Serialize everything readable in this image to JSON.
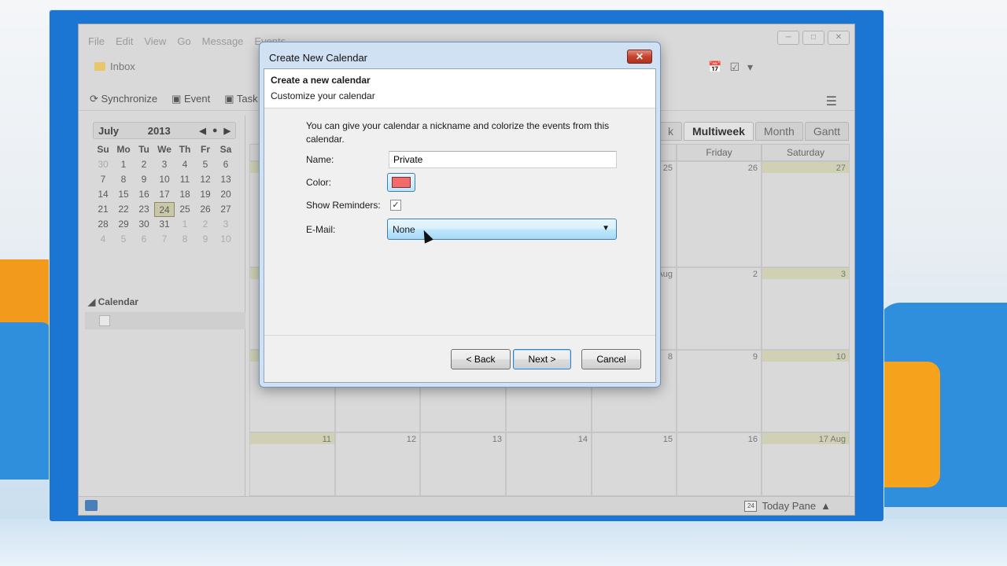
{
  "app": {
    "menu": [
      "File",
      "Edit",
      "View",
      "Go",
      "Message",
      "Events"
    ],
    "folder_tab": "Inbox",
    "toolbar": {
      "sync_label": "Synchronize",
      "event_label": "Event",
      "task_label": "Task"
    }
  },
  "mini_calendar": {
    "month": "July",
    "year": "2013",
    "weekdays": [
      "Su",
      "Mo",
      "Tu",
      "We",
      "Th",
      "Fr",
      "Sa"
    ],
    "days": [
      [
        "30",
        "1",
        "2",
        "3",
        "4",
        "5",
        "6"
      ],
      [
        "7",
        "8",
        "9",
        "10",
        "11",
        "12",
        "13"
      ],
      [
        "14",
        "15",
        "16",
        "17",
        "18",
        "19",
        "20"
      ],
      [
        "21",
        "22",
        "23",
        "24",
        "25",
        "26",
        "27"
      ],
      [
        "28",
        "29",
        "30",
        "31",
        "1",
        "2",
        "3"
      ],
      [
        "4",
        "5",
        "6",
        "7",
        "8",
        "9",
        "10"
      ]
    ],
    "today": "24"
  },
  "calendar_pane": {
    "header": "Calendar"
  },
  "views": {
    "partial": "k",
    "multiweek": "Multiweek",
    "month": "Month",
    "gantt": "Gantt"
  },
  "multiweek": {
    "day_headers": [
      "",
      "",
      "",
      "",
      "",
      "Friday",
      "Saturday"
    ],
    "rows": [
      [
        "",
        "",
        "",
        "",
        "25",
        "26",
        "27"
      ],
      [
        "",
        "",
        "",
        "",
        "Aug",
        "2",
        "3"
      ],
      [
        "",
        "",
        "",
        "",
        "8",
        "9",
        "10"
      ],
      [
        "11",
        "12",
        "13",
        "14",
        "15",
        "16",
        "17 Aug"
      ]
    ]
  },
  "status": {
    "today_pane": "Today Pane",
    "today_pane_date": "24"
  },
  "dialog": {
    "title": "Create New Calendar",
    "heading": "Create a new calendar",
    "subheading": "Customize your calendar",
    "description": "You can give your calendar a nickname and colorize the events from this calendar.",
    "name_label": "Name:",
    "name_value": "Private",
    "color_label": "Color:",
    "color_value": "#f26a6a",
    "reminders_label": "Show Reminders:",
    "reminders_checked": true,
    "email_label": "E-Mail:",
    "email_value": "None",
    "back_label": "< Back",
    "next_label": "Next >",
    "cancel_label": "Cancel"
  }
}
